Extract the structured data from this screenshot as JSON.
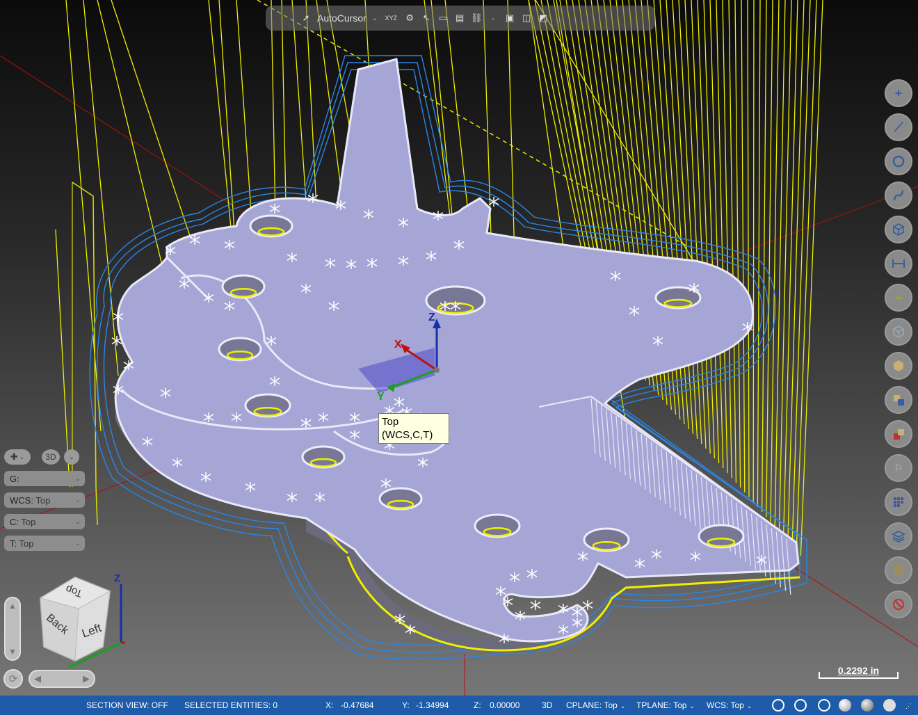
{
  "toolbar": {
    "autocursor_label": "AutoCursor",
    "xyz_label": "XYZ"
  },
  "right_tools": [
    {
      "icon": "plus-point-icon"
    },
    {
      "icon": "line-icon"
    },
    {
      "icon": "circle-icon"
    },
    {
      "icon": "spline-icon"
    },
    {
      "icon": "solid-box-icon"
    },
    {
      "icon": "dimension-icon"
    },
    {
      "icon": "analyze-icon"
    },
    {
      "icon": "wireframe-cube-icon"
    },
    {
      "icon": "shaded-cube-icon"
    },
    {
      "icon": "color-icon"
    },
    {
      "icon": "clear-color-icon"
    },
    {
      "icon": "level-icon"
    },
    {
      "icon": "grid-icon"
    },
    {
      "icon": "layers-icon"
    },
    {
      "icon": "settings-gear-icon"
    },
    {
      "icon": "no-entry-icon"
    }
  ],
  "left_panel": {
    "view_mode": "3D",
    "g_label": "G:",
    "wcs_label": "WCS:",
    "wcs_value": "Top",
    "c_label": "C:",
    "c_value": "Top",
    "t_label": "T:",
    "t_value": "Top"
  },
  "view_cube": {
    "top_face": "Top",
    "back_face": "Back",
    "left_face": "Left",
    "axis_z": "Z"
  },
  "gnomon": {
    "x": "X",
    "y": "Y",
    "z": "Z"
  },
  "tooltip": {
    "line1": "Top",
    "line2": "(WCS,C,T)"
  },
  "scale": {
    "label": "0.2292 in"
  },
  "status": {
    "section_view": "SECTION VIEW: OFF",
    "selected": "SELECTED ENTITIES: 0",
    "x_label": "X:",
    "x_value": "-0.47684",
    "y_label": "Y:",
    "y_value": "-1.34994",
    "z_label": "Z:",
    "z_value": "0.00000",
    "mode": "3D",
    "cplane": "CPLANE: Top",
    "tplane": "TPLANE: Top",
    "wcs": "WCS: Top"
  },
  "colors": {
    "part_fill": "#a5a5d2",
    "part_edge": "#e6e6f5",
    "toolpath_blue": "#2c8ef0",
    "toolpath_yellow": "#f4f400",
    "axis_red": "#c01010",
    "status_bg": "#1e5ba8"
  }
}
